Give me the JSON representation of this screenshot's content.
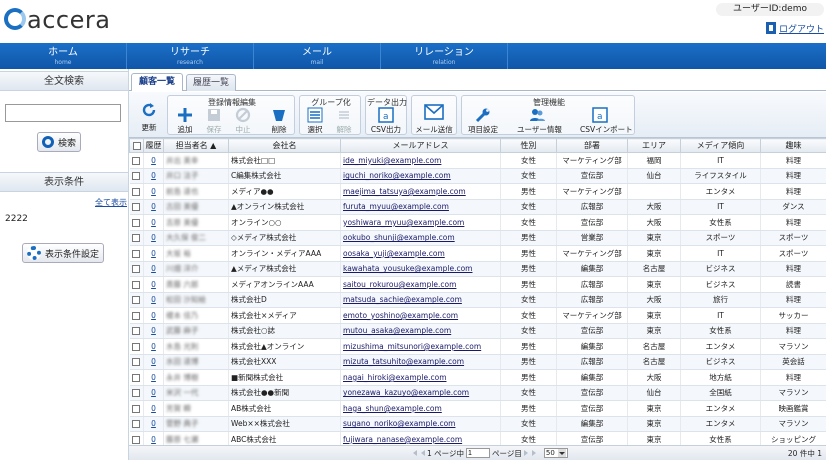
{
  "brand": {
    "logo": "accera",
    "accent": "#1a6fc2"
  },
  "header": {
    "user_id": "ユーザーID:demo",
    "logout": "ログアウト"
  },
  "nav": [
    {
      "label": "ホーム",
      "sub": "home"
    },
    {
      "label": "リサーチ",
      "sub": "research"
    },
    {
      "label": "メール",
      "sub": "mail"
    },
    {
      "label": "リレーション",
      "sub": "relation"
    }
  ],
  "sidebar": {
    "search_title": "全文検索",
    "search_value": "",
    "search_button": "検索",
    "cond_title": "表示条件",
    "show_all": "全て表示",
    "cond_value": "2222",
    "cond_button": "表示条件設定"
  },
  "tabs": [
    {
      "label": "顧客一覧"
    },
    {
      "label": "履歴一覧"
    }
  ],
  "toolbar": {
    "refresh": "更新",
    "edit_group": "登録情報編集",
    "add": "追加",
    "save": "保存",
    "stop": "中止",
    "delete": "削除",
    "group_group": "グループ化",
    "select": "選択",
    "release": "解除",
    "data_group": "データ出力",
    "csv_out": "CSV出力",
    "mail": "メール送信",
    "admin_group": "管理機能",
    "item_setting": "項目設定",
    "user_info": "ユーザー情報",
    "csv_import": "CSVインポート"
  },
  "columns": [
    "履歴",
    "担当者名 ▲",
    "会社名",
    "メールアドレス",
    "性別",
    "部署",
    "エリア",
    "メディア傾向",
    "趣味"
  ],
  "rows": [
    {
      "count": "0",
      "name": "井出 美幸",
      "company": "株式会社□□",
      "email": "ide_miyuki@example.com",
      "gender": "女性",
      "dept": "マーケティング部",
      "area": "福岡",
      "media": "IT",
      "hobby": "料理"
    },
    {
      "count": "0",
      "name": "井口 法子",
      "company": "C編集株式会社",
      "email": "iguchi_noriko@example.com",
      "gender": "女性",
      "dept": "宣伝部",
      "area": "仙台",
      "media": "ライフスタイル",
      "hobby": "料理"
    },
    {
      "count": "0",
      "name": "前島 達也",
      "company": "メディア●●",
      "email": "maejima_tatsuya@example.com",
      "gender": "男性",
      "dept": "マーケティング部",
      "area": "",
      "media": "エンタメ",
      "hobby": "料理"
    },
    {
      "count": "0",
      "name": "古田 美優",
      "company": "▲オンライン株式会社",
      "email": "furuta_myuu@example.com",
      "gender": "女性",
      "dept": "広報部",
      "area": "大阪",
      "media": "IT",
      "hobby": "ダンス"
    },
    {
      "count": "0",
      "name": "吉原 美優",
      "company": "オンライン○○",
      "email": "yoshiwara_myuu@example.com",
      "gender": "女性",
      "dept": "宣伝部",
      "area": "大阪",
      "media": "女性系",
      "hobby": "料理"
    },
    {
      "count": "0",
      "name": "大久保 俊二",
      "company": "◇メディア株式会社",
      "email": "ookubo_shunji@example.com",
      "gender": "男性",
      "dept": "営業部",
      "area": "東京",
      "media": "スポーツ",
      "hobby": "スポーツ"
    },
    {
      "count": "0",
      "name": "大坂 裕",
      "company": "オンライン・メディアAAA",
      "email": "oosaka_yuji@example.com",
      "gender": "男性",
      "dept": "マーケティング部",
      "area": "東京",
      "media": "IT",
      "hobby": "スポーツ"
    },
    {
      "count": "0",
      "name": "川畑 洋介",
      "company": "▲メディア株式会社",
      "email": "kawahata_yousuke@example.com",
      "gender": "男性",
      "dept": "編集部",
      "area": "名古屋",
      "media": "ビジネス",
      "hobby": "料理"
    },
    {
      "count": "0",
      "name": "斎藤 六郎",
      "company": "メディアオンラインAAA",
      "email": "saitou_rokurou@example.com",
      "gender": "男性",
      "dept": "広報部",
      "area": "東京",
      "media": "ビジネス",
      "hobby": "読書"
    },
    {
      "count": "0",
      "name": "松田 沙知絵",
      "company": "株式会社D",
      "email": "matsuda_sachie@example.com",
      "gender": "女性",
      "dept": "広報部",
      "area": "大阪",
      "media": "旅行",
      "hobby": "料理"
    },
    {
      "count": "0",
      "name": "榎本 佳乃",
      "company": "株式会社×メディア",
      "email": "emoto_yoshino@example.com",
      "gender": "女性",
      "dept": "マーケティング部",
      "area": "東京",
      "media": "IT",
      "hobby": "サッカー"
    },
    {
      "count": "0",
      "name": "武藤 麻子",
      "company": "株式会社○誌",
      "email": "mutou_asaka@example.com",
      "gender": "女性",
      "dept": "宣伝部",
      "area": "東京",
      "media": "女性系",
      "hobby": "料理"
    },
    {
      "count": "0",
      "name": "水島 光則",
      "company": "株式会社▲オンライン",
      "email": "mizushima_mitsunori@example.com",
      "gender": "男性",
      "dept": "編集部",
      "area": "名古屋",
      "media": "エンタメ",
      "hobby": "マラソン"
    },
    {
      "count": "0",
      "name": "水田 達博",
      "company": "株式会社XXX",
      "email": "mizuta_tatsuhito@example.com",
      "gender": "男性",
      "dept": "広報部",
      "area": "名古屋",
      "media": "ビジネス",
      "hobby": "英会話"
    },
    {
      "count": "0",
      "name": "永井 博樹",
      "company": "■新聞株式会社",
      "email": "nagai_hiroki@example.com",
      "gender": "男性",
      "dept": "編集部",
      "area": "大阪",
      "media": "地方紙",
      "hobby": "料理"
    },
    {
      "count": "0",
      "name": "米沢 一代",
      "company": "株式会社●●新聞",
      "email": "yonezawa_kazuyo@example.com",
      "gender": "女性",
      "dept": "宣伝部",
      "area": "仙台",
      "media": "全国紙",
      "hobby": "マラソン"
    },
    {
      "count": "0",
      "name": "芳賀 瞬",
      "company": "AB株式会社",
      "email": "haga_shun@example.com",
      "gender": "男性",
      "dept": "宣伝部",
      "area": "東京",
      "media": "エンタメ",
      "hobby": "映画鑑賞"
    },
    {
      "count": "0",
      "name": "菅野 典子",
      "company": "Web××株式会社",
      "email": "sugano_noriko@example.com",
      "gender": "女性",
      "dept": "編集部",
      "area": "東京",
      "media": "エンタメ",
      "hobby": "マラソン"
    },
    {
      "count": "0",
      "name": "藤原 七瀬",
      "company": "ABC株式会社",
      "email": "fujiwara_nanase@example.com",
      "gender": "女性",
      "dept": "宣伝部",
      "area": "東京",
      "media": "女性系",
      "hobby": "ショッピング"
    },
    {
      "count": "0",
      "name": "長友 宗太",
      "company": "◆◆誌株式会社",
      "email": "nagatomo_souta@example.com",
      "gender": "男性",
      "dept": "宣伝部",
      "area": "東京",
      "media": "男性誌",
      "hobby": "料理"
    }
  ],
  "pager": {
    "page_prefix": "1 ページ中",
    "page_value": "1",
    "page_suffix": "ページ目",
    "per_page": "50",
    "total": "20 件中 1"
  }
}
